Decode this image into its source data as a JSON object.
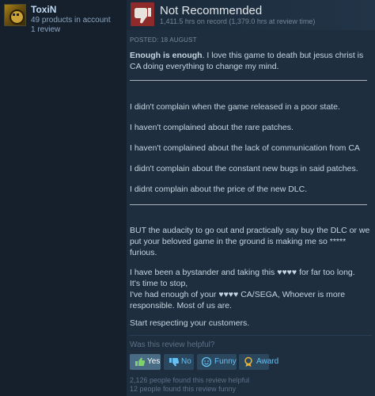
{
  "reviewer": {
    "name": "ToxiN",
    "products": "49 products in account",
    "reviews": "1 review"
  },
  "review": {
    "verdict": "Not Recommended",
    "hours": "1,411.5 hrs on record (1,379.0 hrs at review time)",
    "posted": "POSTED: 18 AUGUST",
    "intro_bold": "Enough is enough",
    "intro_rest": ". I love this game to death but jesus christ is CA doing everything to change my mind.",
    "complaints": [
      "I didn't complain when the game released in a poor state.",
      "I haven't complained about the rare patches.",
      "I haven't complained about the lack of communication from CA",
      "I didn't complain about the constant new bugs in said patches.",
      "I didnt complain about the price of the new DLC."
    ],
    "audacity": "BUT the audacity to go out and practically say buy the DLC or we put your beloved game in the ground is making me so ***** furious.",
    "bystander1": "I have been a bystander and taking this ♥♥♥♥ for far too long.",
    "bystander2": "It's time to stop,",
    "bystander3": "I've had enough of your ♥♥♥♥ CA/SEGA, Whoever is more responsible. Most of us are.",
    "closing": "Start respecting your customers."
  },
  "helpful": {
    "question": "Was this review helpful?",
    "yes": "Yes",
    "no": "No",
    "funny": "Funny",
    "award": "Award",
    "stat_helpful": "2,126 people found this review helpful",
    "stat_funny": "12 people found this review funny"
  },
  "colors": {
    "background": "#1b2838",
    "link": "#66c0f4",
    "not_recommended": "#8e2a2a"
  }
}
